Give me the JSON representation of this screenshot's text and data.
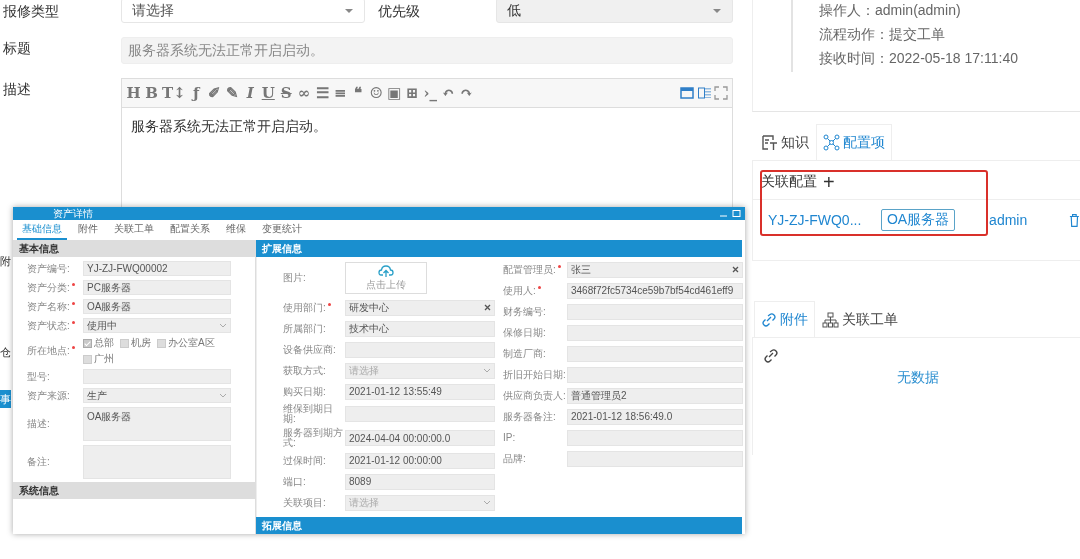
{
  "repair_form": {
    "type_label": "报修类型",
    "type_select": {
      "placeholder": "请选择"
    },
    "priority_label": "优先级",
    "priority_select": {
      "value": "低"
    },
    "title_label": "标题",
    "title_field": {
      "value": "服务器系统无法正常开启启动。"
    },
    "description_label": "描述",
    "editor": {
      "toolbar": [
        {
          "glyph": "H",
          "kind": "plain"
        },
        {
          "glyph": "B",
          "kind": "plain"
        },
        {
          "glyph": "T↕",
          "kind": "plain"
        },
        {
          "glyph": "ƒ",
          "kind": "plain"
        },
        {
          "glyph": "✐",
          "kind": "plain"
        },
        {
          "glyph": "✎",
          "kind": "plain"
        },
        {
          "glyph": "I",
          "kind": "italic"
        },
        {
          "glyph": "U",
          "kind": "underline"
        },
        {
          "glyph": "S",
          "kind": "strike"
        },
        {
          "glyph": "∞",
          "kind": "plain"
        },
        {
          "glyph": "☰",
          "kind": "plain"
        },
        {
          "glyph": "≡",
          "kind": "plain"
        },
        {
          "glyph": "❝",
          "kind": "plain"
        },
        {
          "glyph": "☺",
          "kind": "plain"
        },
        {
          "glyph": "▣",
          "kind": "plain"
        },
        {
          "glyph": "⊞",
          "kind": "plain"
        },
        {
          "glyph": "›_",
          "kind": "plain"
        },
        {
          "glyph": "↶",
          "kind": "plain"
        },
        {
          "glyph": "↷",
          "kind": "plain"
        }
      ],
      "content": "服务器系统无法正常开启启动。"
    }
  },
  "edge_fragments": [
    {
      "kind": "label",
      "text": "附"
    },
    {
      "kind": "label",
      "text": "仓"
    },
    {
      "kind": "button",
      "text": "事"
    }
  ],
  "history": {
    "lines": [
      "操作人：admin(admin)",
      "流程动作：提交工单",
      "接收时间：2022-05-18 17:11:40"
    ]
  },
  "upper_tabs": [
    {
      "label": "知识",
      "kind": "knowledge",
      "selected": false
    },
    {
      "label": "配置项",
      "kind": "network",
      "selected": true
    }
  ],
  "related_config": {
    "title": "关联配置",
    "add": "+",
    "highlighted": true,
    "items": [
      {
        "code": "YJ-ZJ-FWQ0...",
        "tag": "OA服务器",
        "owner": "admin"
      }
    ]
  },
  "lower_tabs": [
    {
      "label": "附件",
      "kind": "link",
      "selected": true
    },
    {
      "label": "关联工单",
      "kind": "tree",
      "selected": false
    }
  ],
  "attachments": {
    "empty_text": "无数据"
  },
  "asset_window": {
    "title": "资产详情",
    "tabs": [
      {
        "label": "基础信息",
        "selected": true
      },
      {
        "label": "附件",
        "selected": false
      },
      {
        "label": "关联工单",
        "selected": false
      },
      {
        "label": "配置关系",
        "selected": false
      },
      {
        "label": "维保",
        "selected": false
      },
      {
        "label": "变更统计",
        "selected": false
      }
    ],
    "basic": {
      "title": "基本信息",
      "fields": [
        {
          "label": "资产编号:",
          "kind": "input",
          "value": "YJ-ZJ-FWQ00002"
        },
        {
          "label": "资产分类:",
          "required": true,
          "kind": "input",
          "value": "PC服务器"
        },
        {
          "label": "资产名称:",
          "required": true,
          "kind": "input",
          "value": "OA服务器"
        },
        {
          "label": "资产状态:",
          "required": true,
          "kind": "select",
          "value": "使用中"
        },
        {
          "label": "所在地点:",
          "required": true,
          "kind": "checks",
          "options": [
            {
              "label": "总部",
              "checked": true
            },
            {
              "label": "机房",
              "checked": false
            },
            {
              "label": "办公室A区",
              "checked": false
            },
            {
              "label": "广州",
              "checked": false
            }
          ]
        },
        {
          "label": "型号:",
          "kind": "input"
        },
        {
          "label": "资产来源:",
          "kind": "select",
          "value": "生产"
        },
        {
          "label": "描述:",
          "kind": "textarea",
          "value": "OA服务器"
        },
        {
          "label": "备注:",
          "kind": "textarea"
        }
      ],
      "bottom_title": "系统信息"
    },
    "extended": {
      "title": "扩展信息",
      "bottom_title": "拓展信息",
      "left": [
        {
          "label": "图片:",
          "kind": "upload",
          "value": "点击上传"
        },
        {
          "label": "使用部门:",
          "required": true,
          "kind": "tagselect",
          "value": "研发中心"
        },
        {
          "label": "所属部门:",
          "kind": "input",
          "value": "技术中心"
        },
        {
          "label": "设备供应商:",
          "kind": "input"
        },
        {
          "label": "获取方式:",
          "kind": "select",
          "placeholder": "请选择"
        },
        {
          "label": "购买日期:",
          "kind": "input",
          "value": "2021-01-12 13:55:49"
        },
        {
          "label": "维保到期日期:",
          "kind": "input"
        },
        {
          "label": "服务器到期方式:",
          "kind": "input",
          "value": "2024-04-04 00:00:00.0"
        },
        {
          "label": "过保时间:",
          "kind": "input",
          "value": "2021-01-12 00:00:00"
        },
        {
          "label": "端口:",
          "kind": "input",
          "value": "8089"
        },
        {
          "label": "关联项目:",
          "kind": "select",
          "placeholder": "请选择"
        }
      ],
      "right": [
        {
          "label": "配置管理员:",
          "required": true,
          "kind": "tagselect",
          "value": "张三"
        },
        {
          "label": "使用人:",
          "required": true,
          "kind": "input",
          "value": "3468f72fc5734ce59b7bf54cd461eff9"
        },
        {
          "label": "财务编号:",
          "kind": "input"
        },
        {
          "label": "保修日期:",
          "kind": "input"
        },
        {
          "label": "制造厂商:",
          "kind": "input"
        },
        {
          "label": "折旧开始日期:",
          "kind": "input"
        },
        {
          "label": "供应商负责人:",
          "kind": "input",
          "value": "普通管理员2"
        },
        {
          "label": "服务器备注:",
          "kind": "input",
          "value": "2021-01-12 18:56:49.0"
        },
        {
          "label": "IP:",
          "kind": "input"
        },
        {
          "label": "品牌:",
          "kind": "input"
        }
      ]
    }
  }
}
